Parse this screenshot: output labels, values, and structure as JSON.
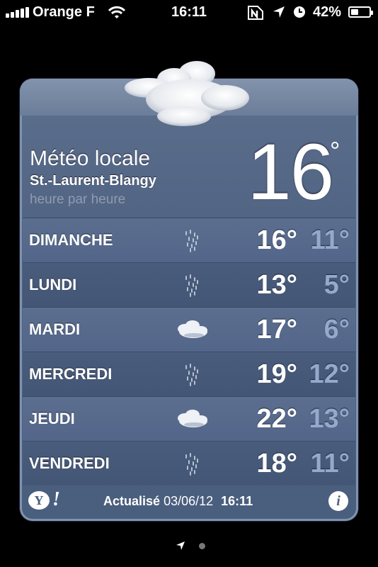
{
  "status_bar": {
    "carrier": "Orange F",
    "time": "16:11",
    "battery_percent": "42%",
    "battery_level": 0.42,
    "icons": [
      "signal-icon",
      "wifi-icon",
      "nike-icon",
      "location-icon",
      "alarm-icon",
      "battery-icon"
    ]
  },
  "widget": {
    "title": "Météo locale",
    "city": "St.-Laurent-Blangy",
    "subtitle": "heure par heure",
    "current_temp": "16",
    "current_deg": "°",
    "current_icon": "cloud-icon",
    "forecast": [
      {
        "day": "DIMANCHE",
        "icon": "rain-icon",
        "high": "16°",
        "low": "11°"
      },
      {
        "day": "LUNDI",
        "icon": "rain-icon",
        "high": "13°",
        "low": "5°"
      },
      {
        "day": "MARDI",
        "icon": "cloud-icon",
        "high": "17°",
        "low": "6°"
      },
      {
        "day": "MERCREDI",
        "icon": "rain-icon",
        "high": "19°",
        "low": "12°"
      },
      {
        "day": "JEUDI",
        "icon": "cloud-icon",
        "high": "22°",
        "low": "13°"
      },
      {
        "day": "VENDREDI",
        "icon": "rain-icon",
        "high": "18°",
        "low": "11°"
      }
    ],
    "footer": {
      "yahoo_y": "Y",
      "yahoo_bang": "!",
      "updated_label": "Actualisé",
      "updated_date": "03/06/12",
      "updated_time": "16:11",
      "info_glyph": "i"
    }
  },
  "pager": {
    "pages": 2,
    "current": 1
  }
}
